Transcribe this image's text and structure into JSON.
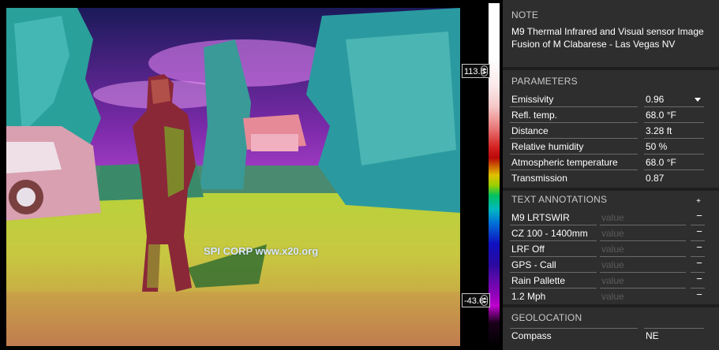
{
  "image": {
    "watermark": "SPI CORP www.x20.org"
  },
  "scale": {
    "max": "113.6",
    "min": "-43.6"
  },
  "note": {
    "title": "NOTE",
    "text": "M9 Thermal Infrared and Visual sensor Image Fusion of M Clabarese - Las Vegas NV"
  },
  "parameters": {
    "title": "PARAMETERS",
    "rows": [
      {
        "label": "Emissivity",
        "value": "0.96"
      },
      {
        "label": "Refl. temp.",
        "value": "68.0 °F"
      },
      {
        "label": "Distance",
        "value": "3.28 ft"
      },
      {
        "label": "Relative humidity",
        "value": "50 %"
      },
      {
        "label": "Atmospheric temperature",
        "value": "68.0 °F"
      },
      {
        "label": "Transmission",
        "value": "0.87"
      }
    ]
  },
  "annotations": {
    "title": "TEXT ANNOTATIONS",
    "add_label": "+",
    "remove_label": "−",
    "value_placeholder": "value",
    "rows": [
      {
        "label": "M9 LRTSWIR"
      },
      {
        "label": "CZ 100 - 1400mm"
      },
      {
        "label": "LRF Off"
      },
      {
        "label": "GPS - Call"
      },
      {
        "label": "Rain Pallette"
      },
      {
        "label": "1.2 Mph"
      }
    ]
  },
  "geolocation": {
    "title": "GEOLOCATION",
    "rows": [
      {
        "label": "Compass",
        "value": "NE"
      }
    ]
  }
}
